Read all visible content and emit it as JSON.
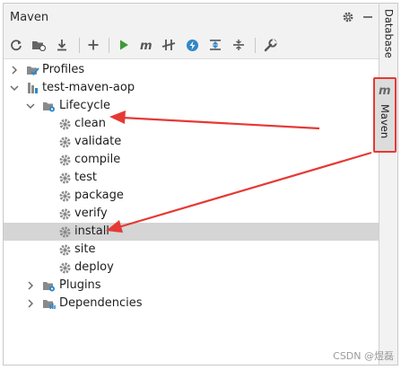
{
  "window": {
    "title": "Maven"
  },
  "toolbar": {
    "tools": [
      "reload-icon",
      "add-folder-icon",
      "download-icon",
      "plus-icon",
      "run-icon",
      "maven-goal-icon",
      "toggle-offline-icon",
      "skip-tests-icon",
      "collapse-all-icon",
      "expand-all-icon",
      "wrench-icon"
    ]
  },
  "tree": {
    "profiles": "Profiles",
    "project": "test-maven-aop",
    "lifecycle": "Lifecycle",
    "phases": [
      "clean",
      "validate",
      "compile",
      "test",
      "package",
      "verify",
      "install",
      "site",
      "deploy"
    ],
    "selected_phase": "install",
    "plugins": "Plugins",
    "dependencies": "Dependencies"
  },
  "side_tabs": {
    "database": "Database",
    "maven": "Maven",
    "maven_icon": "m"
  },
  "colors": {
    "accent_red": "#e53935",
    "selection": "#d5d5d5",
    "run_green": "#3d9a36",
    "blue": "#2f87c8"
  },
  "watermark": "CSDN @煜磊"
}
